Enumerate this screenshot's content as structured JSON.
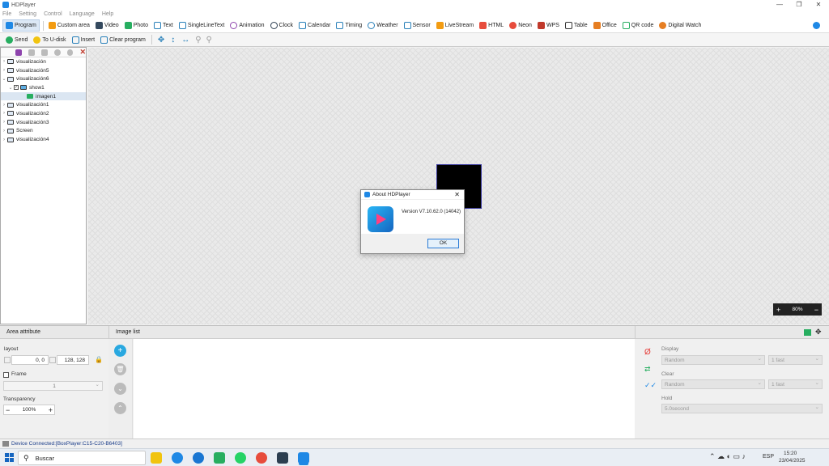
{
  "window": {
    "title": "HDPlayer",
    "controls": [
      "—",
      "❐",
      "✕"
    ]
  },
  "menu": [
    "File",
    "Setting",
    "Control",
    "Language",
    "Help"
  ],
  "toolbar1": [
    {
      "label": "Program",
      "icon": "program-icon",
      "color": "#1e88e5"
    },
    {
      "label": "Custom area",
      "icon": "custom-area-icon",
      "color": "#f39c12"
    },
    {
      "label": "Video",
      "icon": "video-icon",
      "color": "#34495e"
    },
    {
      "label": "Photo",
      "icon": "photo-icon",
      "color": "#27ae60"
    },
    {
      "label": "Text",
      "icon": "text-icon",
      "color": "#2980b9"
    },
    {
      "label": "SingleLineText",
      "icon": "single-line-text-icon",
      "color": "#2980b9"
    },
    {
      "label": "Animation",
      "icon": "animation-icon",
      "color": "#8e44ad"
    },
    {
      "label": "Clock",
      "icon": "clock-icon",
      "color": "#2c3e50"
    },
    {
      "label": "Calendar",
      "icon": "calendar-icon",
      "color": "#2980b9"
    },
    {
      "label": "Timing",
      "icon": "timing-icon",
      "color": "#2980b9"
    },
    {
      "label": "Weather",
      "icon": "weather-icon",
      "color": "#2980b9"
    },
    {
      "label": "Sensor",
      "icon": "sensor-icon",
      "color": "#2980b9"
    },
    {
      "label": "LiveStream",
      "icon": "livestream-icon",
      "color": "#f39c12"
    },
    {
      "label": "HTML",
      "icon": "html-icon",
      "color": "#e74c3c"
    },
    {
      "label": "Neon",
      "icon": "neon-icon",
      "color": "#e74c3c"
    },
    {
      "label": "WPS",
      "icon": "wps-icon",
      "color": "#c0392b"
    },
    {
      "label": "Table",
      "icon": "table-icon",
      "color": "#333333"
    },
    {
      "label": "Office",
      "icon": "office-icon",
      "color": "#e67e22"
    },
    {
      "label": "QR code",
      "icon": "qr-code-icon",
      "color": "#27ae60"
    },
    {
      "label": "Digital Watch",
      "icon": "digital-watch-icon",
      "color": "#e67e22"
    }
  ],
  "toolbar2": [
    {
      "label": "Send",
      "icon": "send-icon",
      "color": "#27ae60"
    },
    {
      "label": "To U-disk",
      "icon": "u-disk-icon",
      "color": "#f1c40f"
    },
    {
      "label": "Insert",
      "icon": "insert-icon",
      "color": "#2980b9"
    },
    {
      "label": "Clear program",
      "icon": "clear-program-icon",
      "color": "#2980b9"
    }
  ],
  "tree": [
    {
      "label": "visualización",
      "level": 0,
      "expanded": false
    },
    {
      "label": "visualización5",
      "level": 0,
      "expanded": false
    },
    {
      "label": "visualización6",
      "level": 0,
      "expanded": true
    },
    {
      "label": "show1",
      "level": 1,
      "expanded": true
    },
    {
      "label": "imagen1",
      "level": 2,
      "selected": true
    },
    {
      "label": "visualización1",
      "level": 0,
      "expanded": false
    },
    {
      "label": "visualización2",
      "level": 0,
      "expanded": false
    },
    {
      "label": "visualización3",
      "level": 0,
      "expanded": false
    },
    {
      "label": "Screen",
      "level": 0,
      "expanded": false
    },
    {
      "label": "visualización4",
      "level": 0,
      "expanded": false
    }
  ],
  "zoom": {
    "minus": "−",
    "plus": "+",
    "value": "80%"
  },
  "dialog": {
    "title": "About HDPlayer",
    "version": "Version V7.10.62.0 (14042)",
    "ok": "OK"
  },
  "area": {
    "header": "Area attribute",
    "layout_label": "layout",
    "position": "0, 0",
    "size": "128, 128",
    "frame_label": "Frame",
    "frame_value": "1",
    "transparency_label": "Transparency",
    "transparency_value": "100%"
  },
  "image_list": {
    "header": "Image list"
  },
  "effects": {
    "display_label": "Display",
    "display_effect": "Random",
    "display_speed": "1 fast",
    "clear_label": "Clear",
    "clear_effect": "Random",
    "clear_speed": "1 fast",
    "hold_label": "Hold",
    "hold_value": "5.0second"
  },
  "status": "Device Connected:[BoxPlayer:C15-C20-B6403]",
  "taskbar": {
    "search_placeholder": "Buscar",
    "lang": "ESP",
    "time": "15:20",
    "date": "23/04/2025"
  }
}
